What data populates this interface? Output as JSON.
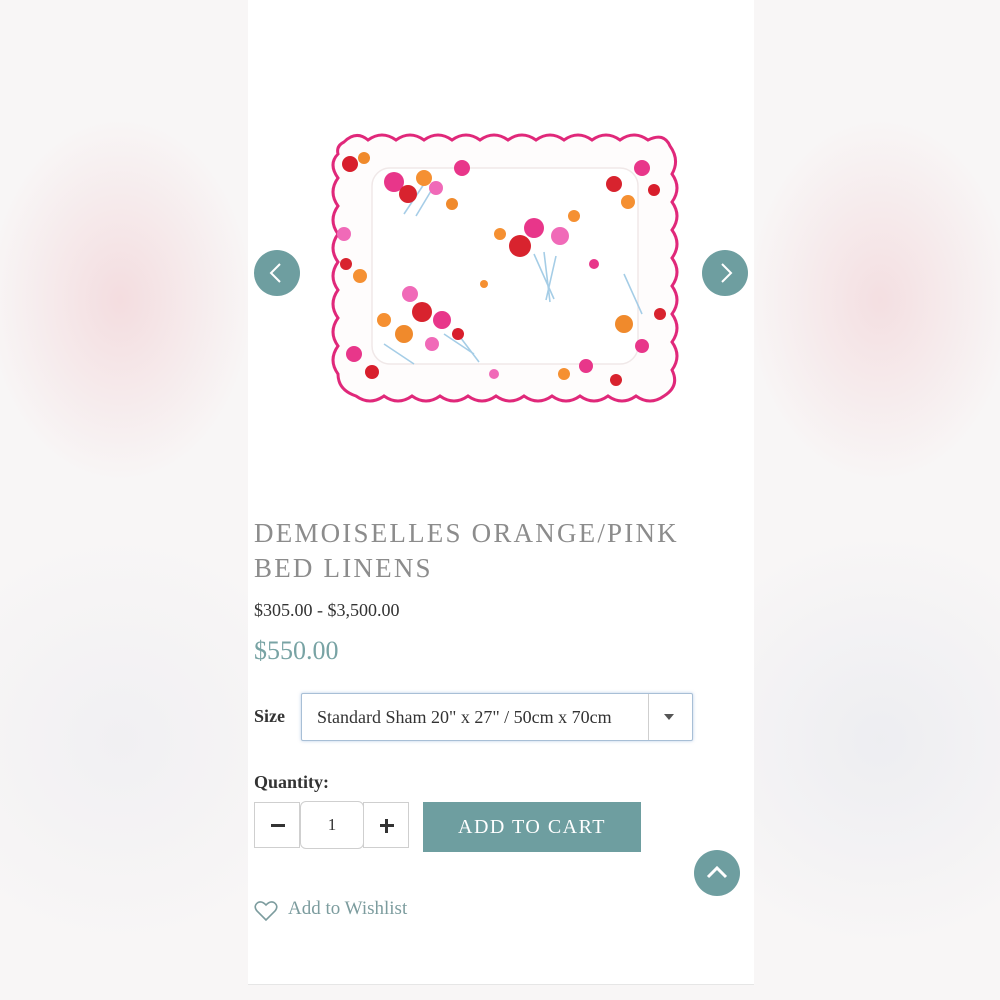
{
  "product": {
    "title": "DEMOISELLES ORANGE/PINK BED LINENS",
    "price_range": "$305.00 - $3,500.00",
    "price": "$550.00"
  },
  "carousel": {
    "prev_icon": "chevron-left-icon",
    "next_icon": "chevron-right-icon"
  },
  "options": {
    "size_label": "Size",
    "size_value": "Standard Sham 20\" x 27\" / 50cm x 70cm"
  },
  "quantity": {
    "label": "Quantity:",
    "value": "1"
  },
  "actions": {
    "add_to_cart": "ADD TO CART",
    "wishlist": "Add to Wishlist",
    "scroll_top_icon": "chevron-up-icon"
  },
  "colors": {
    "accent": "#6e9ea0",
    "price": "#78a3a4",
    "title": "#8c8c8c"
  }
}
